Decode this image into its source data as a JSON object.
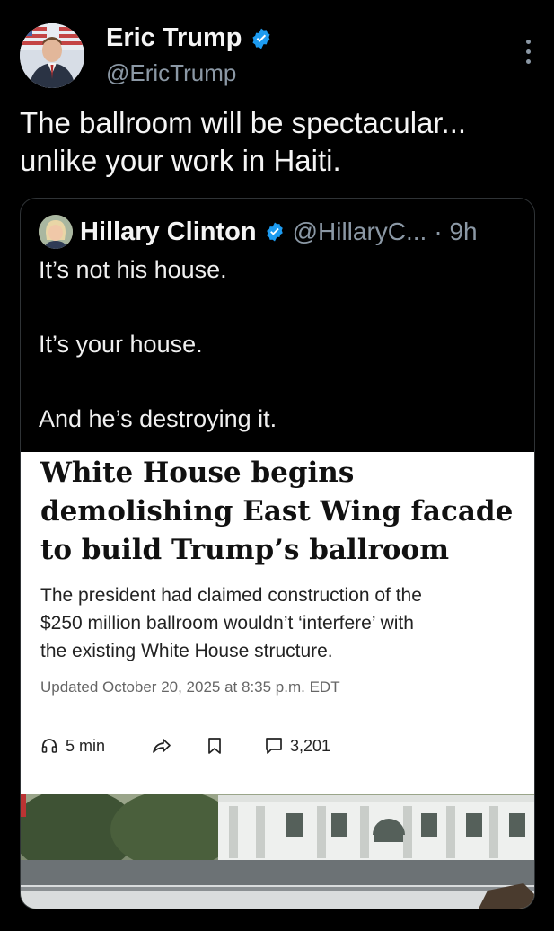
{
  "tweet": {
    "author": {
      "name": "Eric Trump",
      "handle": "@EricTrump"
    },
    "text_lines": [
      "The ballroom will be spectacular...",
      "unlike your work in Haiti."
    ]
  },
  "quoted_tweet": {
    "author": {
      "name": "Hillary Clinton",
      "handle": "@HillaryC...",
      "time": "· 9h"
    },
    "text_lines": [
      "It’s not his house.",
      "It’s your house.",
      "And he’s destroying it."
    ]
  },
  "article": {
    "headline_lines": [
      "White House begins",
      "demolishing East Wing facade",
      "to build Trump’s ballroom"
    ],
    "deck_lines": [
      "The president had claimed construction of the",
      "$250 million ballroom wouldn’t ‘interfere’ with",
      "the existing White House structure."
    ],
    "updated": "Updated October 20, 2025 at 8:35 p.m. EDT",
    "read_time": "5 min",
    "comments": "3,201"
  },
  "colors": {
    "verified": "#1d9bf0",
    "background": "#000000",
    "muted": "#8b98a5",
    "border": "#2f3336"
  },
  "icons": [
    "verified-badge-icon",
    "more-options-icon",
    "headphones-icon",
    "share-icon",
    "bookmark-icon",
    "comment-icon"
  ]
}
